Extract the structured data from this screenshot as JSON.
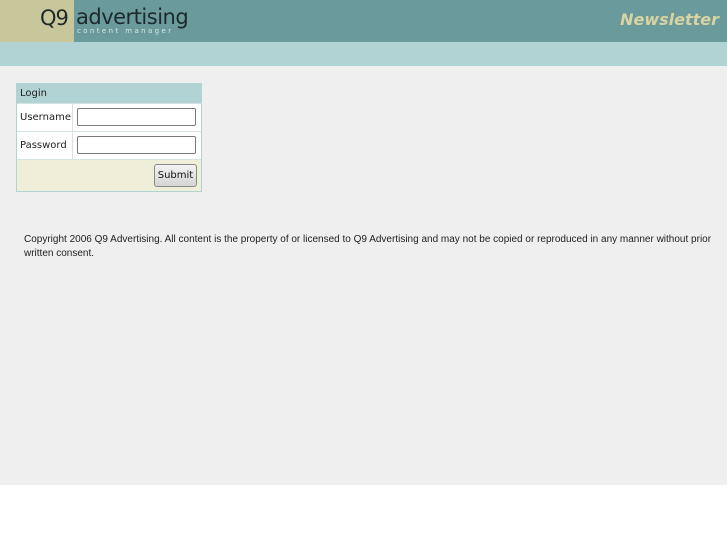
{
  "header": {
    "logo_q9": "Q9",
    "logo_word": "advertising",
    "logo_sub": "content manager",
    "section_title": "Newsletter"
  },
  "login": {
    "heading": "Login",
    "username_label": "Username",
    "username_value": "",
    "password_label": "Password",
    "password_value": "",
    "submit_label": "Submit"
  },
  "footer": {
    "copyright": "Copyright 2006 Q9 Advertising. All content is the property of or licensed to Q9 Advertising and may not be copied or reproduced in any manner without prior written consent."
  },
  "colors": {
    "header_bg": "#6a9a9b",
    "logo_bg": "#c8c79c",
    "subbar_bg": "#b2d3d4",
    "content_bg": "#efefef",
    "newsletter_text": "#d8d3a3",
    "submit_row_bg": "#eeeed9"
  }
}
